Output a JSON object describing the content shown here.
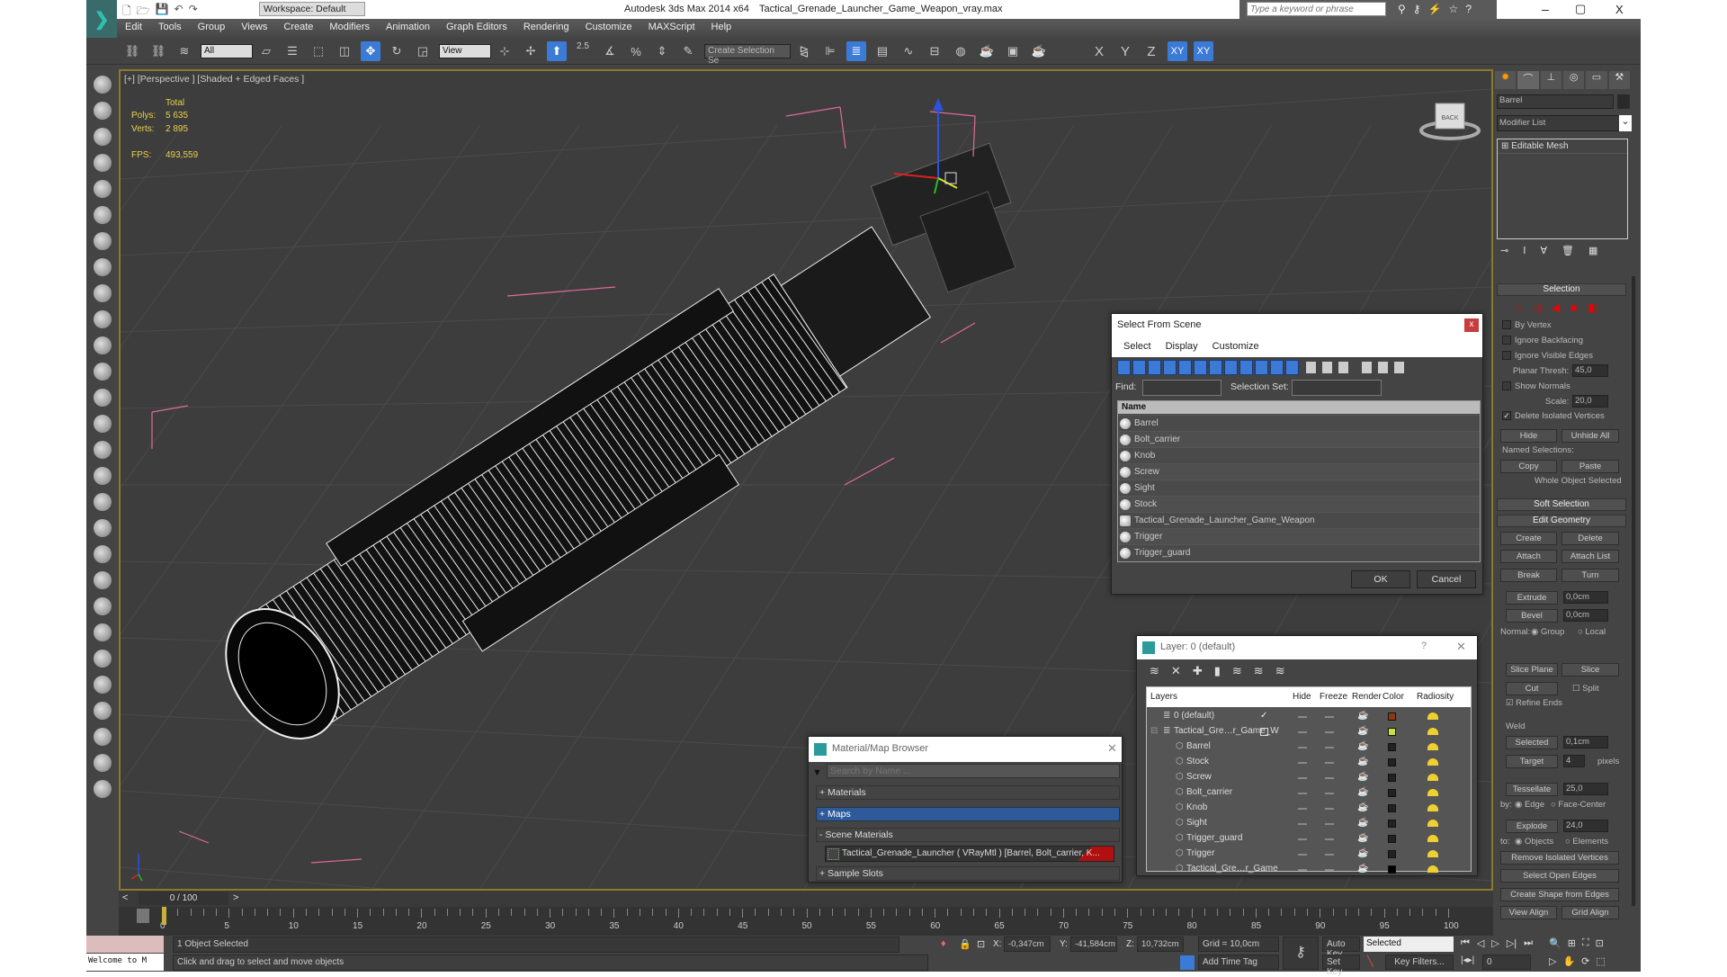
{
  "window": {
    "app_title": "Autodesk 3ds Max  2014 x64",
    "file_title": "Tactical_Grenade_Launcher_Game_Weapon_vray.max",
    "workspace": "Workspace: Default",
    "search_placeholder": "Type a keyword or phrase",
    "minimize": "–",
    "maximize": "▢",
    "close": "X"
  },
  "menu": [
    "Edit",
    "Tools",
    "Group",
    "Views",
    "Create",
    "Modifiers",
    "Animation",
    "Graph Editors",
    "Rendering",
    "Customize",
    "MAXScript",
    "Help"
  ],
  "toolbar": {
    "filter": "All",
    "ref_coord": "View",
    "selection_set_placeholder": "Create Selection Se",
    "snap_label": "2.5",
    "axis_x": "X",
    "axis_y": "Y",
    "axis_z": "Z",
    "axis_xy": "XY",
    "axis_xy2": "XY",
    "icons": [
      "select-link-icon",
      "unlink-icon",
      "bind-spacewarp-icon",
      "filter-dropdown",
      "select-object-icon",
      "select-by-name-icon",
      "rect-region-icon",
      "window-crossing-icon",
      "move-icon",
      "rotate-icon",
      "scale-icon",
      "ref-coord-dropdown",
      "pivot-icon",
      "manipulate-icon",
      "keyboard-shortcut-icon",
      "snap-icon",
      "angle-snap-icon",
      "percent-snap-icon",
      "spinner-snap-icon",
      "edit-named-sel-icon",
      "named-sel-dropdown",
      "mirror-icon",
      "align-icon",
      "layer-manager-icon",
      "scene-explorer-icon",
      "curve-editor-icon",
      "schematic-icon",
      "material-editor-icon",
      "render-setup-icon",
      "rendered-frame-icon",
      "render-icon"
    ],
    "active": [
      "move-icon",
      "keyboard-shortcut-icon",
      "layer-manager-icon"
    ]
  },
  "left_toolbar_icons": [
    "create-geometry-icon",
    "shapes-icon",
    "lights-icon",
    "cameras-icon",
    "helpers-icon",
    "spacewarps-icon",
    "systems-icon",
    "box-icon",
    "sphere-icon",
    "cylinder-icon",
    "torus-icon",
    "cone-icon",
    "sun-icon",
    "teapot-icon",
    "plane-icon",
    "particles-icon",
    "compound-icon",
    "patch-icon",
    "nurbs-icon",
    "foliage-icon",
    "stairs-icon",
    "door-icon",
    "window-icon",
    "sphere2-icon",
    "material-icon",
    "globe-icon",
    "utility-icon",
    "help-icon"
  ],
  "viewport": {
    "label": "[+] [Perspective ] [Shaded + Edged Faces ]",
    "stats_header": "Total",
    "polys_label": "Polys:",
    "polys": "5 635",
    "verts_label": "Verts:",
    "verts": "2 895",
    "fps_label": "FPS:",
    "fps": "493,559",
    "viewcube": "BACK",
    "stat_color": "#e8d24a"
  },
  "command_panel": {
    "object_name": "Barrel",
    "modifier_list": "Modifier List",
    "stack": [
      "Editable Mesh"
    ],
    "selection": {
      "title": "Selection",
      "by_vertex": "By Vertex",
      "ignore_backfacing": "Ignore Backfacing",
      "ignore_visible_edges": "Ignore Visible Edges",
      "planar_thresh": "Planar Thresh:",
      "planar_value": "45,0",
      "show_normals": "Show Normals",
      "scale": "Scale:",
      "scale_value": "20,0",
      "delete_isolated": "Delete Isolated Vertices",
      "hide": "Hide",
      "unhide_all": "Unhide All",
      "named_selections": "Named Selections:",
      "copy": "Copy",
      "paste": "Paste",
      "status": "Whole Object Selected"
    },
    "soft_selection": "Soft Selection",
    "edit_geometry": {
      "title": "Edit Geometry",
      "create": "Create",
      "delete": "Delete",
      "attach": "Attach",
      "attach_list": "Attach List",
      "break": "Break",
      "turn": "Turn",
      "extrude": "Extrude",
      "extrude_value": "0,0cm",
      "bevel": "Bevel",
      "bevel_value": "0,0cm",
      "normal": "Normal:",
      "group": "Group",
      "local": "Local",
      "slice_plane": "Slice Plane",
      "slice": "Slice",
      "cut": "Cut",
      "split": "Split",
      "refine_ends": "Refine Ends",
      "weld": "Weld",
      "selected": "Selected",
      "selected_value": "0,1cm",
      "target": "Target",
      "target_value": "4",
      "pixels": "pixels",
      "tessellate": "Tessellate",
      "tessellate_value": "25,0",
      "by": "by:",
      "edge": "Edge",
      "face_center": "Face-Center",
      "explode": "Explode",
      "explode_value": "24,0",
      "to": "to:",
      "objects": "Objects",
      "elements": "Elements",
      "remove_isolated": "Remove Isolated Vertices",
      "select_open_edges": "Select Open Edges",
      "create_shape": "Create Shape from Edges",
      "view_align": "View Align",
      "grid_align": "Grid Align"
    }
  },
  "select_from_scene": {
    "title": "Select From Scene",
    "close": "x",
    "menu": [
      "Select",
      "Display",
      "Customize"
    ],
    "find_label": "Find:",
    "selection_set_label": "Selection Set:",
    "column": "Name",
    "items": [
      {
        "name": "Barrel",
        "icon": "geometry-icon"
      },
      {
        "name": "Bolt_carrier",
        "icon": "geometry-icon"
      },
      {
        "name": "Knob",
        "icon": "geometry-icon"
      },
      {
        "name": "Screw",
        "icon": "geometry-icon"
      },
      {
        "name": "Sight",
        "icon": "geometry-icon"
      },
      {
        "name": "Stock",
        "icon": "geometry-icon"
      },
      {
        "name": "Tactical_Grenade_Launcher_Game_Weapon",
        "icon": "group-icon"
      },
      {
        "name": "Trigger",
        "icon": "geometry-icon"
      },
      {
        "name": "Trigger_guard",
        "icon": "geometry-icon"
      }
    ],
    "ok": "OK",
    "cancel": "Cancel"
  },
  "layer_manager": {
    "title": "Layer: 0 (default)",
    "help": "?",
    "close": "✕",
    "columns": [
      "Layers",
      "Hide",
      "Freeze",
      "Render",
      "Color",
      "Radiosity"
    ],
    "rows": [
      {
        "name": "0 (default)",
        "level": 0,
        "color": "#8b3a10",
        "active": "✓"
      },
      {
        "name": "Tactical_Gre…r_Game_W",
        "level": 0,
        "color": "#c8e040",
        "active": "",
        "expander": "⊟"
      },
      {
        "name": "Barrel",
        "level": 1,
        "color": "#222222"
      },
      {
        "name": "Stock",
        "level": 1,
        "color": "#222222"
      },
      {
        "name": "Screw",
        "level": 1,
        "color": "#222222"
      },
      {
        "name": "Bolt_carrier",
        "level": 1,
        "color": "#222222"
      },
      {
        "name": "Knob",
        "level": 1,
        "color": "#222222"
      },
      {
        "name": "Sight",
        "level": 1,
        "color": "#222222"
      },
      {
        "name": "Trigger_guard",
        "level": 1,
        "color": "#222222"
      },
      {
        "name": "Trigger",
        "level": 1,
        "color": "#222222"
      },
      {
        "name": "Tactical_Gre…r_Game",
        "level": 1,
        "color": "#000000"
      }
    ]
  },
  "material_browser": {
    "title": "Material/Map Browser",
    "search_placeholder": "Search by Name ...",
    "groups": [
      "+ Materials",
      "+ Maps",
      "- Scene Materials"
    ],
    "scene_material": "Tactical_Grenade_Launcher  ( VRayMtl )  [Barrel, Bolt_carrier, K...",
    "sample_slots": "+ Sample Slots"
  },
  "timeline": {
    "frame": "0 / 100",
    "prev": "<",
    "next": ">",
    "ticks": [
      0,
      5,
      10,
      15,
      20,
      25,
      30,
      35,
      40,
      45,
      50,
      55,
      60,
      65,
      70,
      75,
      80,
      85,
      90,
      95,
      100
    ]
  },
  "status": {
    "selected": "1 Object Selected",
    "prompt": "Click and drag to select and move objects",
    "listener": "Welcome to M",
    "x_label": "X:",
    "x": "-0,347cm",
    "y_label": "Y:",
    "y": "-41,584cm",
    "z_label": "Z:",
    "z": "10,732cm",
    "grid": "Grid = 10,0cm",
    "add_time_tag": "Add Time Tag",
    "auto_key": "Auto Key",
    "set_key": "Set Key",
    "key_mode": "Selected",
    "key_filters": "Key Filters...",
    "current_frame": "0"
  }
}
